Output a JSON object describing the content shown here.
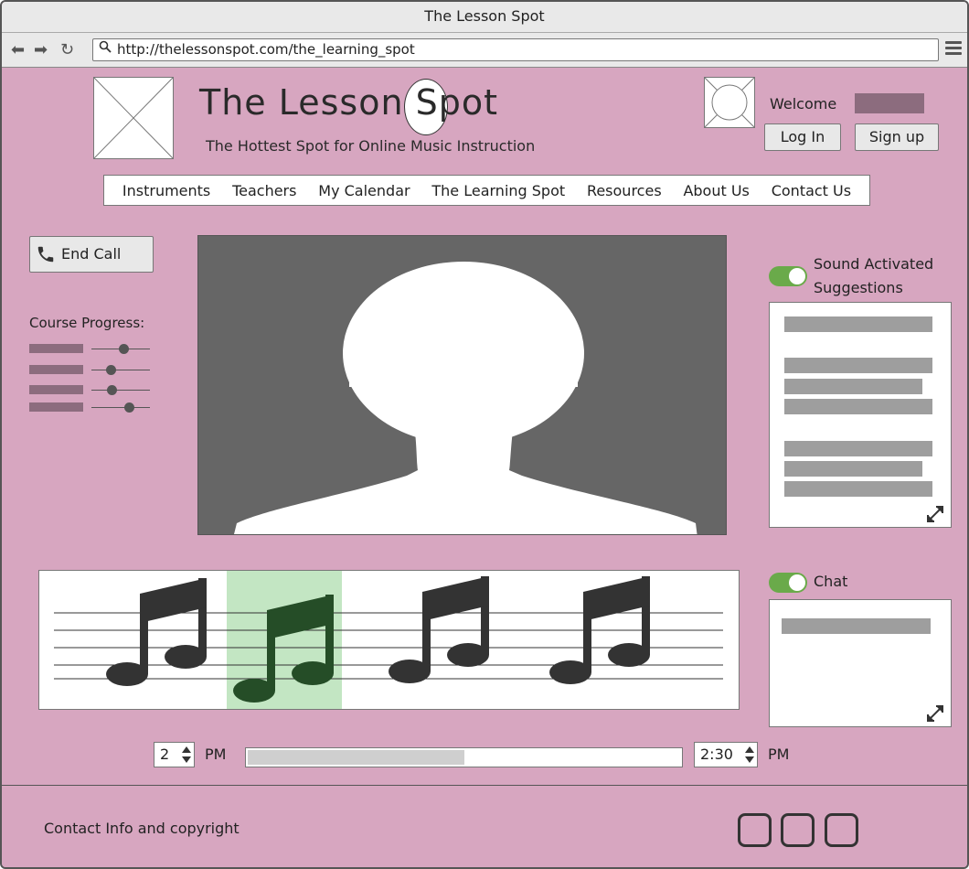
{
  "browser": {
    "title": "The Lesson Spot",
    "url": "http://thelessonspot.com/the_learning_spot"
  },
  "header": {
    "site_title": "The Lesson Spot",
    "tagline": "The Hottest Spot for Online Music Instruction",
    "welcome": "Welcome",
    "login_label": "Log In",
    "signup_label": "Sign up"
  },
  "nav": {
    "items": [
      "Instruments",
      "Teachers",
      "My Calendar",
      "The Learning Spot",
      "Resources",
      "About Us",
      "Contact Us"
    ]
  },
  "call": {
    "end_call_label": "End Call"
  },
  "course_progress": {
    "label": "Course Progress:",
    "sliders": [
      0.55,
      0.33,
      0.35,
      0.64
    ]
  },
  "suggestions": {
    "toggle_on": true,
    "label_line1": "Sound Activated",
    "label_line2": "Suggestions"
  },
  "chat": {
    "toggle_on": true,
    "label": "Chat"
  },
  "sheet_music": {
    "notes_count": 4,
    "highlighted_index": 1
  },
  "time": {
    "start_hour": "2",
    "start_ampm": "PM",
    "end_time": "2:30",
    "end_ampm": "PM",
    "progress": 0.5
  },
  "footer": {
    "text": "Contact Info and copyright"
  },
  "colors": {
    "page_bg": "#d7a6c0",
    "toggle_on": "#6aaa4a",
    "placeholder_mauve": "#8c6c7e",
    "highlight_green": "#c3e6c3"
  }
}
